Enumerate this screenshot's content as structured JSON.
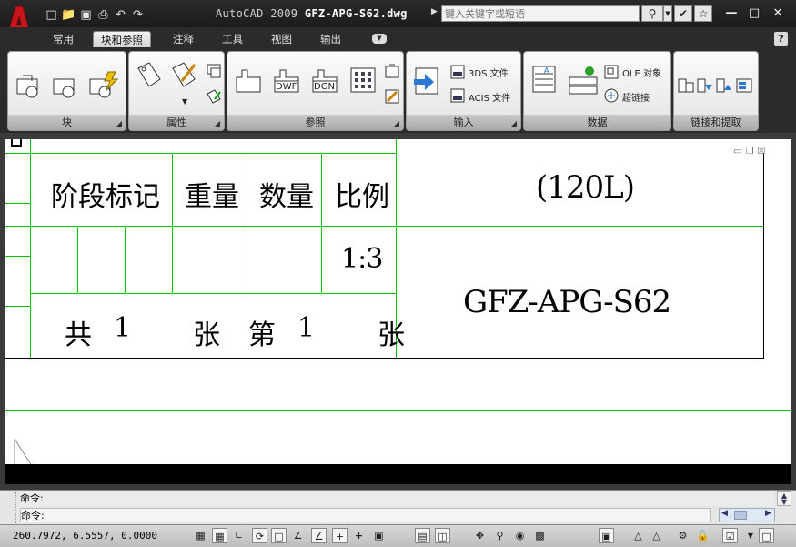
{
  "window": {
    "app_name": "AutoCAD 2009",
    "file_name": "GFZ-APG-S62.dwg",
    "search_placeholder": "键入关键字或短语"
  },
  "quick_access": [
    "new-icon",
    "open-icon",
    "save-icon",
    "print-icon",
    "undo-icon",
    "redo-icon"
  ],
  "tabs": [
    {
      "label": "常用",
      "active": false
    },
    {
      "label": "块和参照",
      "active": true
    },
    {
      "label": "注释",
      "active": false
    },
    {
      "label": "工具",
      "active": false
    },
    {
      "label": "视图",
      "active": false
    },
    {
      "label": "输出",
      "active": false
    }
  ],
  "help_label": "?",
  "ribbon": {
    "block": {
      "title": "块"
    },
    "attributes": {
      "title": "属性"
    },
    "reference": {
      "title": "参照",
      "dwf": "DWF",
      "dgn": "DGN"
    },
    "import": {
      "title": "输入",
      "item_3ds": "3DS 文件",
      "item_acis": "ACIS 文件"
    },
    "data": {
      "title": "数据",
      "ole": "OLE 对象",
      "hyperlink": "超链接"
    },
    "link_extract": {
      "title": "链接和提取"
    }
  },
  "title_block": {
    "col_stage": "阶段标记",
    "col_weight": "重量",
    "col_qty": "数量",
    "col_scale": "比例",
    "scale_value": "1:3",
    "volume": "(120L)",
    "drawing_no": "GFZ-APG-S62",
    "sheets_total_prefix": "共",
    "sheets_total": "1",
    "sheets_unit1": "张",
    "sheet_no_prefix": "第",
    "sheet_no": "1",
    "sheets_unit2": "张"
  },
  "command_line": {
    "line1": "命令:",
    "line2": "命令:"
  },
  "status": {
    "coordinates": "260.7972, 6.5557, 0.0000"
  }
}
